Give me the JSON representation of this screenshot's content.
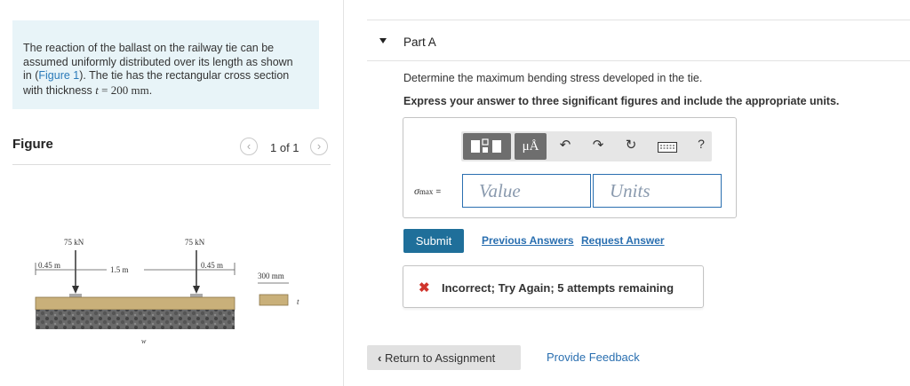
{
  "intro": {
    "line1": "The reaction of the ballast on the railway tie can be",
    "line2": "assumed uniformly distributed over its length as shown",
    "line3_pre": "in (",
    "figure_link": "Figure 1",
    "line3_post": "). The tie has the rectangular cross section",
    "line4_pre": "with thickness ",
    "t_var": "t",
    "t_value": " = 200 mm",
    "period": "."
  },
  "figure": {
    "title": "Figure",
    "pager": "1 of 1",
    "prev_icon": "chevron-left-icon",
    "next_icon": "chevron-right-icon",
    "load_left": "75 kN",
    "load_right": "75 kN",
    "dim_left": "0.45 m",
    "dim_mid": "1.5 m",
    "dim_right": "0.45 m",
    "width_label": "300 mm",
    "t_label": "t",
    "w_label": "w"
  },
  "part": {
    "title": "Part A",
    "question": "Determine the maximum bending stress developed in the tie.",
    "instruction": "Express your answer to three significant figures and include the appropriate units."
  },
  "toolbar": {
    "icons": [
      "templates-icon",
      "mu-angstrom-icon",
      "undo-icon",
      "redo-icon",
      "reset-icon",
      "keyboard-icon",
      "help-icon"
    ],
    "mu_label": "μÅ",
    "help_label": "?"
  },
  "answer": {
    "var_symbol": "σ",
    "var_sub": "max",
    "equals": "=",
    "value_placeholder": "Value",
    "units_placeholder": "Units"
  },
  "actions": {
    "submit": "Submit",
    "previous_answers": "Previous Answers",
    "request_answer": "Request Answer"
  },
  "feedback": {
    "icon": "x-icon",
    "text": "Incorrect; Try Again; 5 attempts remaining",
    "status_color": "#d0342c"
  },
  "footer": {
    "return_label": "Return to Assignment",
    "provide_feedback": "Provide Feedback"
  },
  "colors": {
    "accent": "#1f6f9a",
    "link": "#2a6fb0",
    "intro_bg": "#e8f4f8"
  }
}
